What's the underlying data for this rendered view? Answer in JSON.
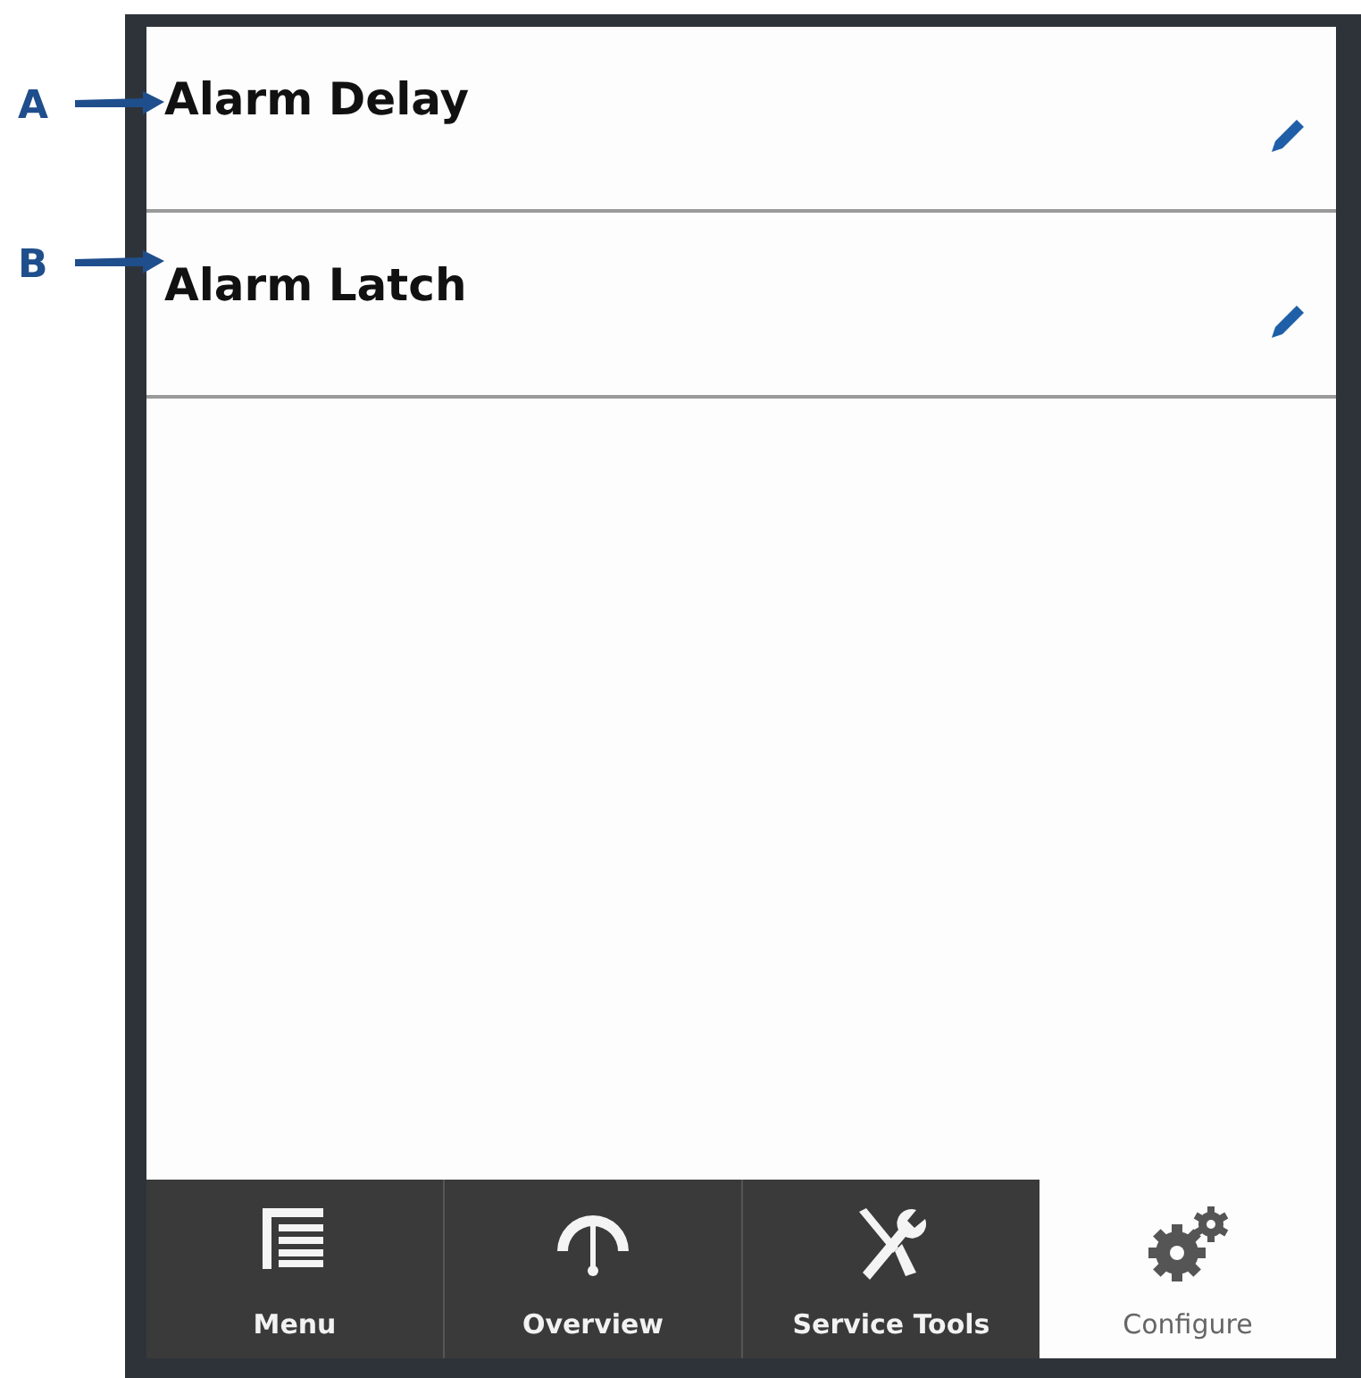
{
  "callouts": [
    {
      "label": "A"
    },
    {
      "label": "B"
    }
  ],
  "items": [
    {
      "label": "Alarm Delay"
    },
    {
      "label": "Alarm Latch"
    }
  ],
  "tabs": [
    {
      "label": "Menu",
      "kind": "menu",
      "selected": false
    },
    {
      "label": "Overview",
      "kind": "gauge",
      "selected": false
    },
    {
      "label": "Service Tools",
      "kind": "tools",
      "selected": false
    },
    {
      "label": "Configure",
      "kind": "gears",
      "selected": true
    }
  ]
}
